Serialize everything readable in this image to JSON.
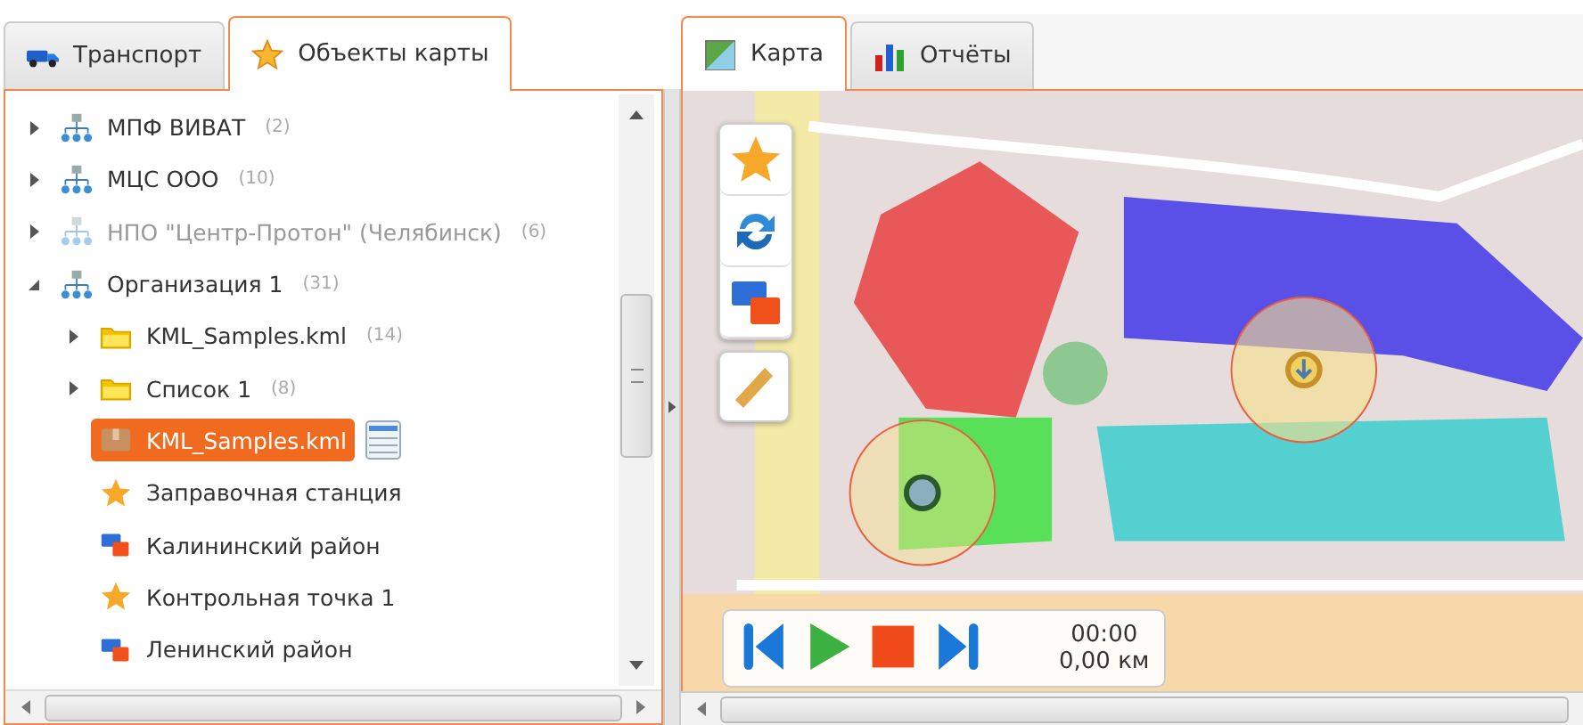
{
  "left_tabs": [
    {
      "label": "Транспорт",
      "kind": "truck",
      "selected": false
    },
    {
      "label": "Объекты карты",
      "kind": "star",
      "selected": true
    }
  ],
  "tree": {
    "items": [
      {
        "name": "МПФ ВИВАТ",
        "count": "(2)",
        "kind": "org",
        "expanded": false,
        "disabled": false,
        "selected": false
      },
      {
        "name": "МЦС ООО",
        "count": "(10)",
        "kind": "org",
        "expanded": false,
        "disabled": false,
        "selected": false
      },
      {
        "name": "НПО \"Центр-Протон\" (Челябинск)",
        "count": "(6)",
        "kind": "org",
        "expanded": false,
        "disabled": true,
        "selected": false
      },
      {
        "name": "Организация 1",
        "count": "(31)",
        "kind": "org",
        "expanded": true,
        "disabled": false,
        "selected": false,
        "children": [
          {
            "name": "KML_Samples.kml",
            "count": "(14)",
            "kind": "folder",
            "expanded": false,
            "disabled": false,
            "selected": false
          },
          {
            "name": "Список 1",
            "count": "(8)",
            "kind": "folder",
            "expanded": false,
            "disabled": false,
            "selected": false
          },
          {
            "name": "KML_Samples.kml",
            "kind": "kml",
            "disabled": false,
            "selected": true,
            "list_button": true
          },
          {
            "name": "Заправочная станция",
            "kind": "star",
            "disabled": false,
            "selected": false
          },
          {
            "name": "Калининский район",
            "kind": "region",
            "disabled": false,
            "selected": false
          },
          {
            "name": "Контрольная точка 1",
            "kind": "star",
            "disabled": false,
            "selected": false
          },
          {
            "name": "Ленинский район",
            "kind": "region",
            "disabled": false,
            "selected": false
          }
        ]
      }
    ]
  },
  "right_tabs": [
    {
      "label": "Карта",
      "kind": "map",
      "selected": true
    },
    {
      "label": "Отчёты",
      "kind": "chart",
      "selected": false
    }
  ],
  "map": {
    "kind": "picture",
    "tools": [
      {
        "kind": "star"
      },
      {
        "kind": "sync"
      },
      {
        "kind": "region"
      },
      {
        "kind": "ruler"
      }
    ],
    "player": {
      "time": "00:00",
      "distance": "0,00 км"
    }
  }
}
